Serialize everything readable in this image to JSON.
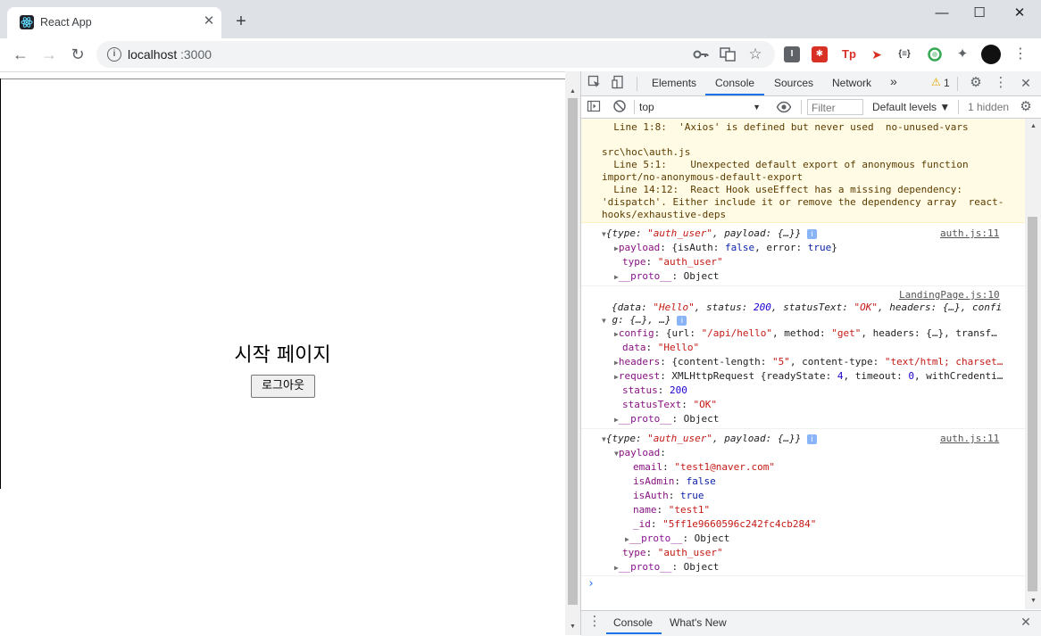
{
  "browser": {
    "tab_title": "React App",
    "tab_close": "✕",
    "new_tab": "+",
    "win_min": "—",
    "win_max": "☐",
    "win_close": "✕",
    "url_host": "localhost",
    "url_port": ":3000",
    "back": "←",
    "forward": "→",
    "reload": "↻",
    "info": "i",
    "ext_tp": "Tp",
    "ext_json": "{≡}"
  },
  "page": {
    "heading": "시작 페이지",
    "logout_button": "로그아웃"
  },
  "devtools": {
    "tabs": [
      "Elements",
      "Console",
      "Sources",
      "Network"
    ],
    "more_tabs": "»",
    "warning_count": "1",
    "context": "top",
    "filter_placeholder": "Filter",
    "levels": "Default levels ▼",
    "hidden": "1 hidden",
    "drawer_tabs": [
      "Console",
      "What's New"
    ],
    "prompt": "›"
  },
  "console": {
    "warning_lines": [
      "  Line 1:8:  'Axios' is defined but never used  no-unused-vars",
      "",
      "src\\hoc\\auth.js",
      "  Line 5:1:    Unexpected default export of anonymous function",
      "import/no-anonymous-default-export",
      "  Line 14:12:  React Hook useEffect has a missing dependency:",
      "'dispatch'. Either include it or remove the dependency array  react-",
      "hooks/exhaustive-deps"
    ],
    "msg1": {
      "source": "auth.js:11",
      "summary_a": "{type: ",
      "summary_type": "\"auth_user\"",
      "summary_b": ", payload: {…}}",
      "payload_key": "payload",
      "payload_val_a": ": {isAuth: ",
      "payload_isauth": "false",
      "payload_val_b": ", error: ",
      "payload_error": "true",
      "payload_val_c": "}",
      "type_key": "type",
      "type_val": "\"auth_user\"",
      "proto_key": "__proto__",
      "proto_val": ": Object"
    },
    "msg2": {
      "source": "LandingPage.js:10",
      "summary_line1_a": "{data: ",
      "summary_data": "\"Hello\"",
      "summary_line1_b": ", status: ",
      "summary_status": "200",
      "summary_line1_c": ", statusText: ",
      "summary_statustext": "\"OK\"",
      "summary_line1_d": ", headers: {…}, confi",
      "summary_line2": "g: {…}, …}",
      "config_key": "config",
      "config_a": ": {url: ",
      "config_url": "\"/api/hello\"",
      "config_b": ", method: ",
      "config_method": "\"get\"",
      "config_c": ", headers: {…}, transf…",
      "data_key": "data",
      "data_val": "\"Hello\"",
      "headers_key": "headers",
      "headers_a": ": {content-length: ",
      "headers_cl": "\"5\"",
      "headers_b": ", content-type: ",
      "headers_ct": "\"text/html; charset…",
      "request_key": "request",
      "request_a": ": XMLHttpRequest {readyState: ",
      "request_rs": "4",
      "request_b": ", timeout: ",
      "request_to": "0",
      "request_c": ", withCredenti…",
      "status_key": "status",
      "status_val": "200",
      "statustext_key": "statusText",
      "statustext_val": "\"OK\"",
      "proto_key": "__proto__",
      "proto_val": ": Object"
    },
    "msg3": {
      "source": "auth.js:11",
      "summary_a": "{type: ",
      "summary_type": "\"auth_user\"",
      "summary_b": ", payload: {…}}",
      "payload_key": "payload",
      "email_key": "email",
      "email_val": "\"test1@naver.com\"",
      "isadmin_key": "isAdmin",
      "isadmin_val": "false",
      "isauth_key": "isAuth",
      "isauth_val": "true",
      "name_key": "name",
      "name_val": "\"test1\"",
      "id_key": "_id",
      "id_val": "\"5ff1e9660596c242fc4cb284\"",
      "inner_proto_key": "__proto__",
      "inner_proto_val": ": Object",
      "type_key": "type",
      "type_val": "\"auth_user\"",
      "proto_key": "__proto__",
      "proto_val": ": Object"
    }
  }
}
